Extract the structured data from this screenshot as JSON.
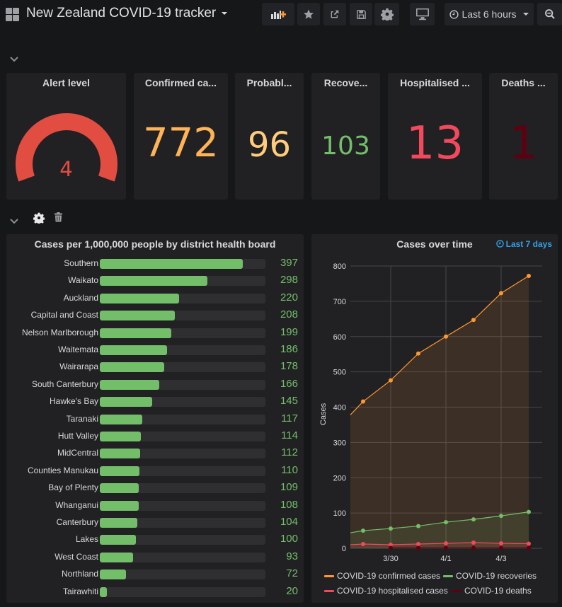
{
  "header": {
    "title": "New Zealand COVID-19 tracker",
    "time_range": "Last 6 hours",
    "buttons": [
      "add-panel",
      "star",
      "share",
      "save",
      "settings",
      "tv-mode",
      "zoom-out"
    ]
  },
  "stats": [
    {
      "title": "Alert level",
      "value": "4",
      "color": "#e24d42",
      "gauge_fraction": 1.0
    },
    {
      "title": "Confirmed ca...",
      "value": "772",
      "color": "#ffb357"
    },
    {
      "title": "Probabl...",
      "value": "96",
      "color": "#ffcb7d"
    },
    {
      "title": "Recove...",
      "value": "103",
      "color": "#73bf69"
    },
    {
      "title": "Hospitalised ...",
      "value": "13",
      "color": "#f2495c"
    },
    {
      "title": "Deaths ...",
      "value": "1",
      "color": "#5f0010"
    }
  ],
  "dhb_panel": {
    "title": "Cases per 1,000,000 people by district health board",
    "max": 460,
    "min": 0,
    "rows": [
      {
        "label": "Southern",
        "value": 397
      },
      {
        "label": "Waikato",
        "value": 298
      },
      {
        "label": "Auckland",
        "value": 220
      },
      {
        "label": "Capital and Coast",
        "value": 208
      },
      {
        "label": "Nelson Marlborough",
        "value": 199
      },
      {
        "label": "Waitemata",
        "value": 186
      },
      {
        "label": "Wairarapa",
        "value": 178
      },
      {
        "label": "South Canterbury",
        "value": 166
      },
      {
        "label": "Hawke's Bay",
        "value": 145
      },
      {
        "label": "Taranaki",
        "value": 117
      },
      {
        "label": "Hutt Valley",
        "value": 114
      },
      {
        "label": "MidCentral",
        "value": 112
      },
      {
        "label": "Counties Manukau",
        "value": 110
      },
      {
        "label": "Bay of Plenty",
        "value": 109
      },
      {
        "label": "Whanganui",
        "value": 108
      },
      {
        "label": "Canterbury",
        "value": 104
      },
      {
        "label": "Lakes",
        "value": 100
      },
      {
        "label": "West Coast",
        "value": 93
      },
      {
        "label": "Northland",
        "value": 72
      },
      {
        "label": "Tairawhiti",
        "value": 20
      }
    ]
  },
  "time_panel": {
    "title": "Cases over time",
    "time_override": "Last 7 days"
  },
  "chart_data": {
    "type": "line",
    "title": "Cases over time",
    "xlabel": "",
    "ylabel": "Cases",
    "ylim": [
      0,
      800
    ],
    "yticks": [
      0,
      100,
      200,
      300,
      400,
      500,
      600,
      700,
      800
    ],
    "x": [
      "3/29",
      "3/30",
      "3/31",
      "4/1",
      "4/2",
      "4/3",
      "4/4"
    ],
    "xtick_labels": [
      "3/30",
      "4/1",
      "4/3"
    ],
    "grid": true,
    "legend": "bottom",
    "series": [
      {
        "name": "COVID-19 confirmed cases",
        "color": "#ff9830",
        "start_value": 378,
        "values": [
          416,
          476,
          552,
          600,
          647,
          723,
          772
        ]
      },
      {
        "name": "COVID-19 recoveries",
        "color": "#73bf69",
        "start_value": 44,
        "values": [
          50,
          56,
          63,
          74,
          82,
          92,
          103
        ]
      },
      {
        "name": "COVID-19 hospitalised cases",
        "color": "#f2495c",
        "start_value": 10,
        "values": [
          12,
          10,
          12,
          14,
          16,
          14,
          13
        ]
      },
      {
        "name": "COVID-19 deaths",
        "color": "#5f0010",
        "start_value": null,
        "values": [
          null,
          1,
          1,
          1,
          1,
          1,
          1
        ]
      }
    ]
  }
}
